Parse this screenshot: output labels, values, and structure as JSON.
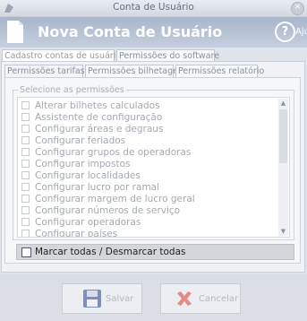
{
  "window": {
    "title": "Conta de Usuário",
    "close_symbol": "×",
    "app_icon": "app-logo-icon",
    "close_icon": "close-icon"
  },
  "banner": {
    "title": "Nova Conta de Usuário",
    "help_label": "Ajuda",
    "help_symbol": "?",
    "icon": "document-icon"
  },
  "outer_tabs": [
    {
      "label": "Cadastro contas de usuários",
      "active": true
    },
    {
      "label": "Permissões do software",
      "active": false
    }
  ],
  "inner_tabs": [
    {
      "label": "Permissões tarifas",
      "active": true
    },
    {
      "label": "Permissões bilhetagem",
      "active": false
    },
    {
      "label": "Permissões relatório",
      "active": false
    }
  ],
  "permissions": {
    "legend": "Selecione as permissões",
    "items": [
      "Alterar bilhetes calculados",
      "Assistente de configuração",
      "Configurar áreas e degraus",
      "Configurar feriados",
      "Configurar grupos de operadoras",
      "Configurar impostos",
      "Configurar localidades",
      "Configurar lucro por ramal",
      "Configurar margem de lucro geral",
      "Configurar números de serviço",
      "Configurar operadoras",
      "Configurar países"
    ],
    "select_all_label": "Marcar todas / Desmarcar todas"
  },
  "footer": {
    "save_label": "Salvar",
    "cancel_label": "Cancelar"
  },
  "colors": {
    "banner": "#b3bfd3",
    "cancel_icon": "#e07a7a",
    "save_icon": "#6d7fb5"
  }
}
